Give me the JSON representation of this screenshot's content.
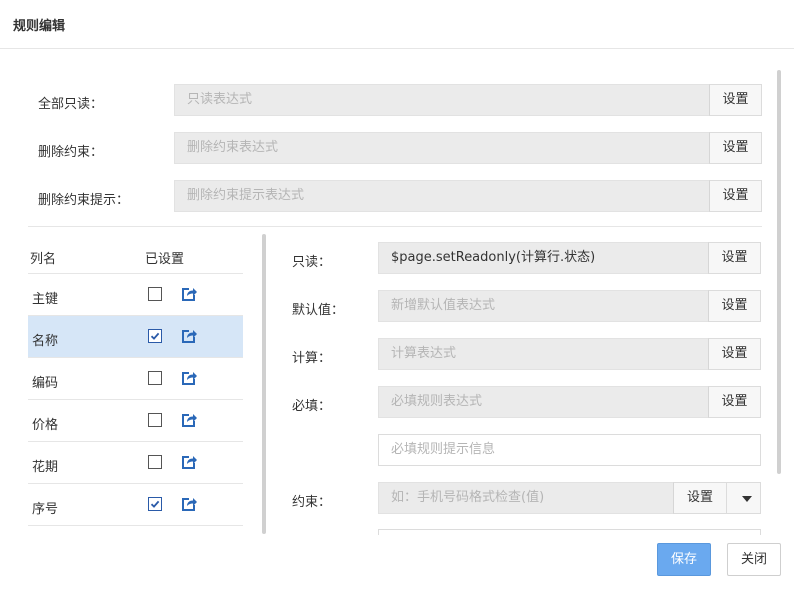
{
  "dialog": {
    "title": "规则编辑"
  },
  "top_rows": [
    {
      "label": "全部只读：",
      "placeholder": "只读表达式",
      "button": "设置"
    },
    {
      "label": "删除约束：",
      "placeholder": "删除约束表达式",
      "button": "设置"
    },
    {
      "label": "删除约束提示：",
      "placeholder": "删除约束提示表达式",
      "button": "设置"
    }
  ],
  "table": {
    "headers": {
      "name": "列名",
      "configured": "已设置"
    },
    "rows": [
      {
        "name": "主键",
        "checked": false,
        "selected": false
      },
      {
        "name": "名称",
        "checked": true,
        "selected": true
      },
      {
        "name": "编码",
        "checked": false,
        "selected": false
      },
      {
        "name": "价格",
        "checked": false,
        "selected": false
      },
      {
        "name": "花期",
        "checked": false,
        "selected": false
      },
      {
        "name": "序号",
        "checked": true,
        "selected": false
      }
    ]
  },
  "detail": {
    "readonly": {
      "label": "只读：",
      "value": "$page.setReadonly(计算行.状态)",
      "button": "设置"
    },
    "default_value": {
      "label": "默认值：",
      "placeholder": "新增默认值表达式",
      "button": "设置"
    },
    "compute": {
      "label": "计算：",
      "placeholder": "计算表达式",
      "button": "设置"
    },
    "required": {
      "label": "必填：",
      "placeholder": "必填规则表达式",
      "button": "设置",
      "message_placeholder": "必填规则提示信息"
    },
    "constraint": {
      "label": "约束：",
      "placeholder": "如：手机号码格式检查(值)",
      "button": "设置"
    }
  },
  "footer": {
    "save": "保存",
    "close": "关闭"
  },
  "colors": {
    "accent": "#6aa9ef",
    "selected_row": "#d6e6f7",
    "field_bg": "#ebebeb",
    "icon_blue": "#2a68b8"
  }
}
